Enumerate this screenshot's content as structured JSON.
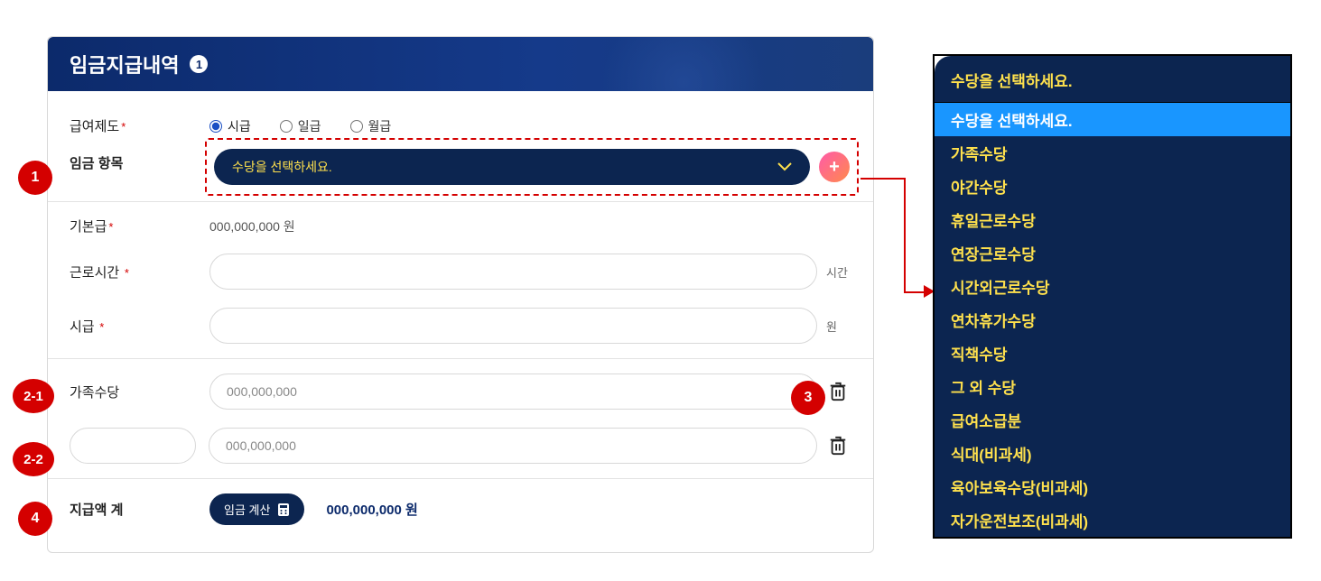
{
  "panel": {
    "title": "임금지급내역",
    "header_badge": "1"
  },
  "pay_system": {
    "label": "급여제도",
    "options": [
      "시급",
      "일급",
      "월급"
    ],
    "selected": "시급"
  },
  "wage_item": {
    "label": "임금 항목",
    "dropdown_placeholder": "수당을 선택하세요."
  },
  "base_pay": {
    "label": "기본급",
    "value": "000,000,000 원"
  },
  "work_hours": {
    "label": "근로시간",
    "value": "",
    "unit": "시간"
  },
  "hourly_rate": {
    "label": "시급",
    "value": "",
    "unit": "원"
  },
  "allowance1": {
    "label": "가족수당",
    "placeholder": "000,000,000"
  },
  "allowance2": {
    "label": "",
    "placeholder": "000,000,000"
  },
  "total": {
    "label": "지급액 계",
    "calc_button": "임금 계산",
    "value": "000,000,000 원"
  },
  "callouts": {
    "c1": "1",
    "c21": "2-1",
    "c22": "2-2",
    "c3": "3",
    "c4": "4"
  },
  "dropdown_popup": {
    "header": "수당을 선택하세요.",
    "selected": "수당을 선택하세요.",
    "options": [
      "수당을 선택하세요.",
      "가족수당",
      "야간수당",
      "휴일근로수당",
      "연장근로수당",
      "시간외근로수당",
      "연차휴가수당",
      "직책수당",
      "그 외 수당",
      "급여소급분",
      "식대(비과세)",
      "육아보육수당(비과세)",
      "자가운전보조(비과세)"
    ]
  }
}
